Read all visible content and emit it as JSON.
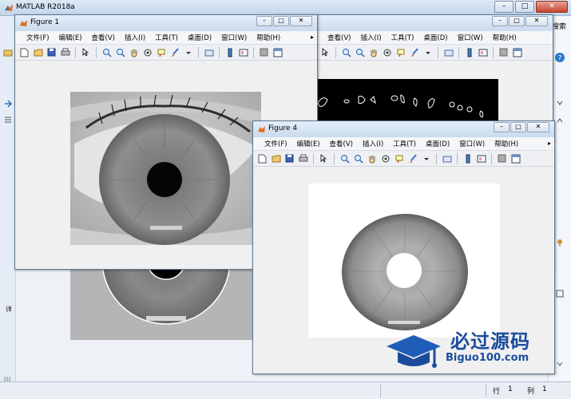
{
  "main_window": {
    "title": "MATLAB R2018a",
    "right_label": "搜索",
    "status": {
      "row_label": "行",
      "row_value": "1",
      "col_label": "列",
      "col_value": "1"
    }
  },
  "figure_menu": [
    "文件(F)",
    "编辑(E)",
    "查看(V)",
    "插入(I)",
    "工具(T)",
    "桌面(D)",
    "窗口(W)",
    "帮助(H)"
  ],
  "figures": {
    "fig1": {
      "title": "Figure 1"
    },
    "fig4": {
      "title": "Figure 4"
    }
  },
  "left_panel_fragment": "详",
  "watermark": {
    "brand": "必过源码",
    "url": "Biguo100.com"
  },
  "colors": {
    "title_bar": "#c9dbee",
    "matlab_orange": "#e46c1c",
    "watermark_blue": "#1b4c9c"
  }
}
